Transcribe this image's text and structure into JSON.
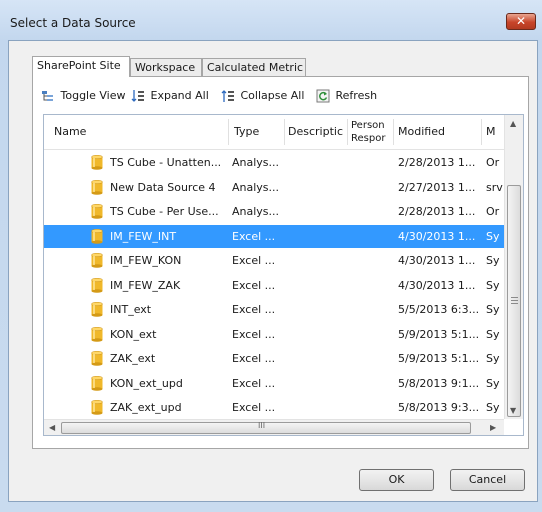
{
  "window": {
    "title": "Select a Data Source",
    "close_glyph": "✕"
  },
  "tabs": [
    {
      "label": "SharePoint Site",
      "active": true
    },
    {
      "label": "Workspace",
      "active": false
    },
    {
      "label": "Calculated Metric",
      "active": false
    }
  ],
  "toolbar": {
    "toggle_view": "Toggle View",
    "expand_all": "Expand All",
    "collapse_all": "Collapse All",
    "refresh": "Refresh"
  },
  "grid": {
    "columns": {
      "name": "Name",
      "type": "Type",
      "description": "Descriptic",
      "person_line1": "Person",
      "person_line2": "Respor",
      "modified": "Modified",
      "m": "M"
    },
    "rows": [
      {
        "name": "TS Cube - Unatten...",
        "type": "Analys...",
        "modified": "2/28/2013 1...",
        "m": "Or",
        "selected": false
      },
      {
        "name": "New Data Source 4",
        "type": "Analys...",
        "modified": "2/27/2013 1...",
        "m": "srv",
        "selected": false
      },
      {
        "name": "TS Cube - Per Use...",
        "type": "Analys...",
        "modified": "2/28/2013 1...",
        "m": "Or",
        "selected": false
      },
      {
        "name": "IM_FEW_INT",
        "type": "Excel ...",
        "modified": "4/30/2013 1...",
        "m": "Sy",
        "selected": true
      },
      {
        "name": "IM_FEW_KON",
        "type": "Excel ...",
        "modified": "4/30/2013 1...",
        "m": "Sy",
        "selected": false
      },
      {
        "name": "IM_FEW_ZAK",
        "type": "Excel ...",
        "modified": "4/30/2013 1...",
        "m": "Sy",
        "selected": false
      },
      {
        "name": "INT_ext",
        "type": "Excel ...",
        "modified": "5/5/2013 6:3...",
        "m": "Sy",
        "selected": false
      },
      {
        "name": "KON_ext",
        "type": "Excel ...",
        "modified": "5/9/2013 5:1...",
        "m": "Sy",
        "selected": false
      },
      {
        "name": "ZAK_ext",
        "type": "Excel ...",
        "modified": "5/9/2013 5:1...",
        "m": "Sy",
        "selected": false
      },
      {
        "name": "KON_ext_upd",
        "type": "Excel ...",
        "modified": "5/8/2013 9:1...",
        "m": "Sy",
        "selected": false
      },
      {
        "name": "ZAK_ext_upd",
        "type": "Excel ...",
        "modified": "5/8/2013 9:3...",
        "m": "Sy",
        "selected": false
      }
    ],
    "hscroll_center": "III",
    "vscroll_center": "≡"
  },
  "buttons": {
    "ok": "OK",
    "cancel": "Cancel"
  },
  "colors": {
    "selection": "#3399ff",
    "datasource_icon": "#f0b82a"
  },
  "icons": {
    "toggle_view": "toggle-view-icon",
    "expand_all": "expand-all-icon",
    "collapse_all": "collapse-all-icon",
    "refresh": "refresh-icon",
    "row": "data-source-cylinder-icon"
  }
}
